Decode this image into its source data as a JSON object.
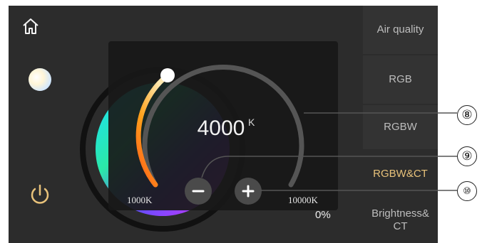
{
  "sidebar": {
    "air_quality": "Air quality",
    "rgb": "RGB",
    "rgbw": "RGBW",
    "rgbw_ct": "RGBW&CT",
    "brightness_ct": "Brightness& CT"
  },
  "brightness_percent": "0%",
  "ct_dialog": {
    "value": "4000",
    "unit": "K",
    "min_label": "1000K",
    "max_label": "10000K"
  },
  "callouts": {
    "eight": "⑧",
    "nine": "⑨",
    "ten": "⑩"
  },
  "colors": {
    "active_tab": "#e8c27a",
    "power_icon": "#e8c27a"
  },
  "icons": [
    "home-icon",
    "color-mode-icon",
    "power-icon",
    "minus-icon",
    "plus-icon"
  ]
}
